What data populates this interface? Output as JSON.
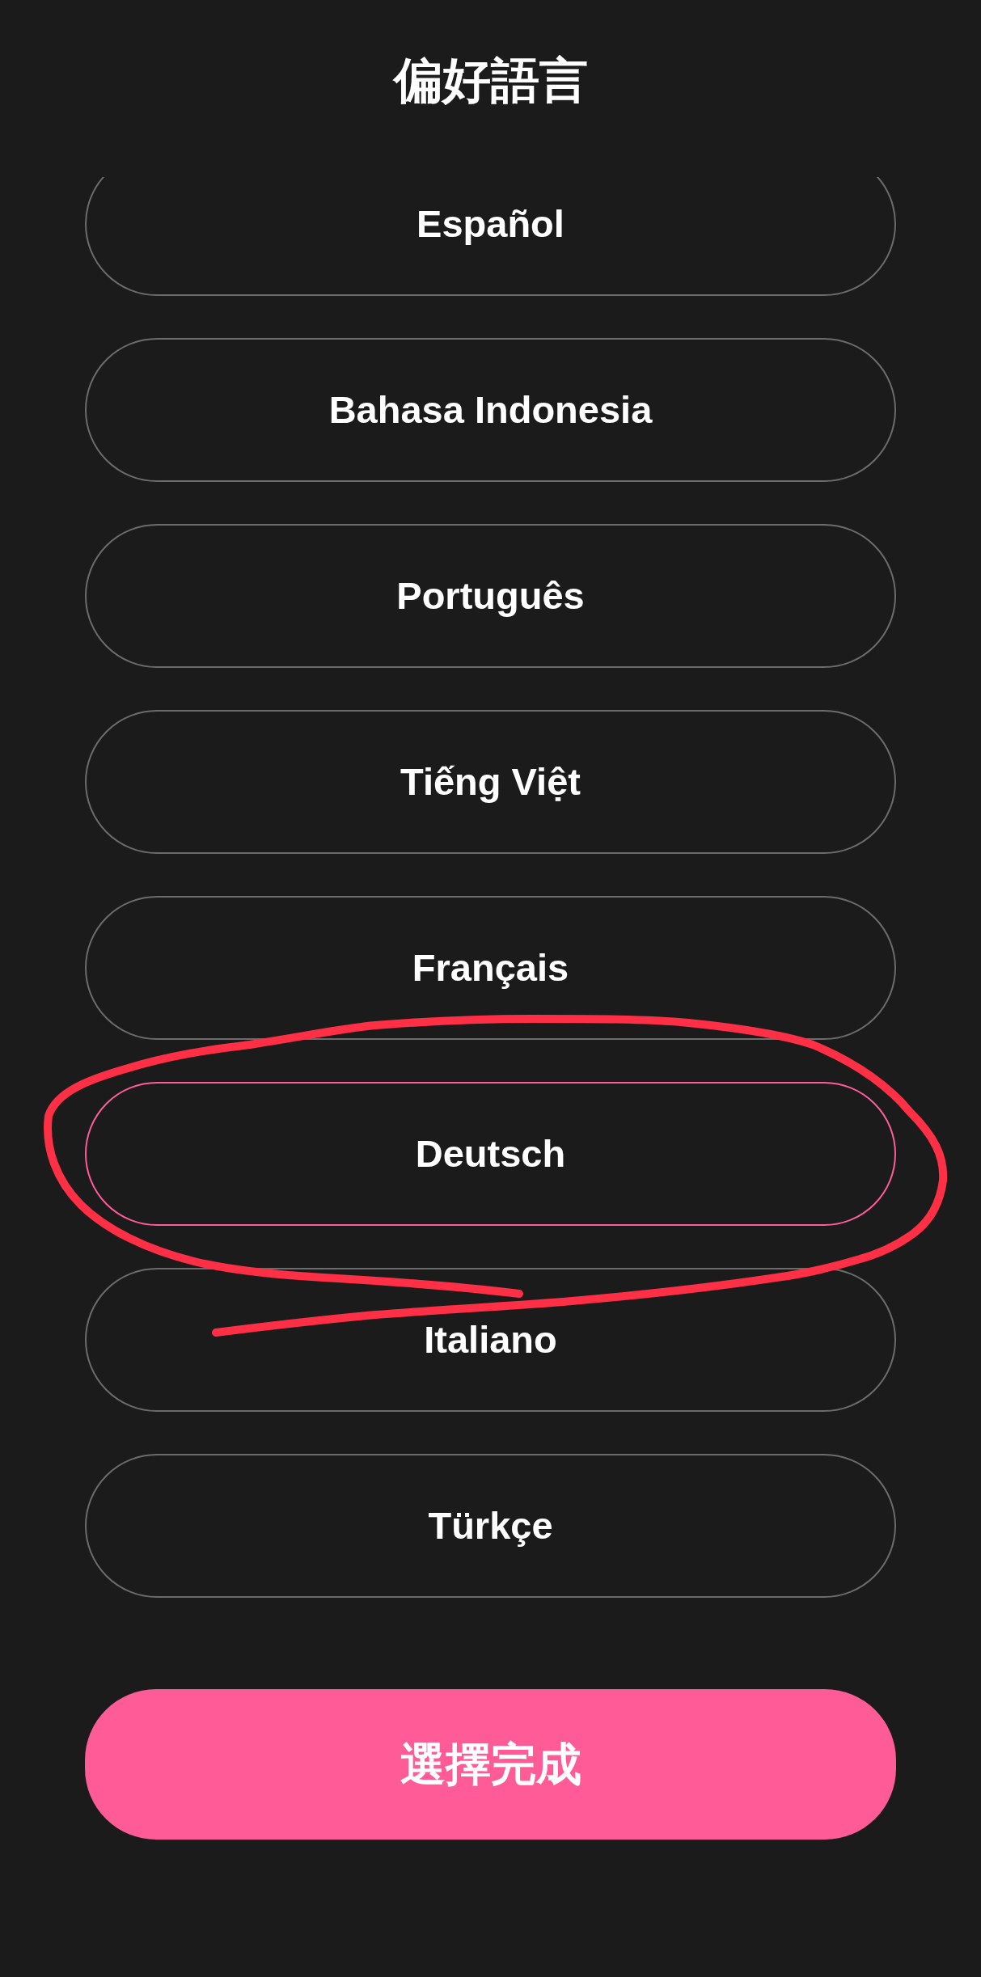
{
  "title": "偏好語言",
  "languages": [
    {
      "label": "Español",
      "selected": false
    },
    {
      "label": "Bahasa Indonesia",
      "selected": false
    },
    {
      "label": "Português",
      "selected": false
    },
    {
      "label": "Tiếng Việt",
      "selected": false
    },
    {
      "label": "Français",
      "selected": false
    },
    {
      "label": "Deutsch",
      "selected": true
    },
    {
      "label": "Italiano",
      "selected": false
    },
    {
      "label": "Türkçe",
      "selected": false
    }
  ],
  "confirm_button": {
    "label": "選擇完成"
  }
}
